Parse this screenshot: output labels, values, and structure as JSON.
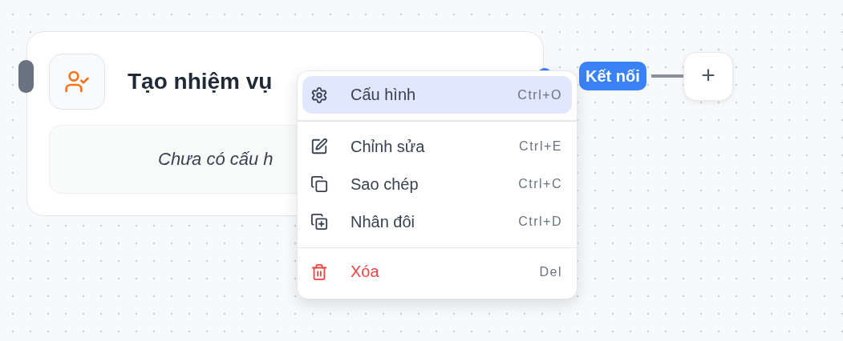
{
  "node": {
    "title": "Tạo nhiệm vụ",
    "config_text": "Chưa có cấu h"
  },
  "connector": {
    "label": "Kết nối",
    "add_button": "+"
  },
  "context_menu": {
    "items": [
      {
        "kind": "action",
        "label": "Cấu hình",
        "shortcut": "Ctrl+O",
        "selected": true
      },
      {
        "kind": "divider"
      },
      {
        "kind": "action",
        "label": "Chỉnh sửa",
        "shortcut": "Ctrl+E",
        "selected": false
      },
      {
        "kind": "action",
        "label": "Sao chép",
        "shortcut": "Ctrl+C",
        "selected": false
      },
      {
        "kind": "action",
        "label": "Nhân đôi",
        "shortcut": "Ctrl+D",
        "selected": false
      },
      {
        "kind": "divider"
      },
      {
        "kind": "danger",
        "label": "Xóa",
        "shortcut": "Del",
        "selected": false
      }
    ]
  }
}
